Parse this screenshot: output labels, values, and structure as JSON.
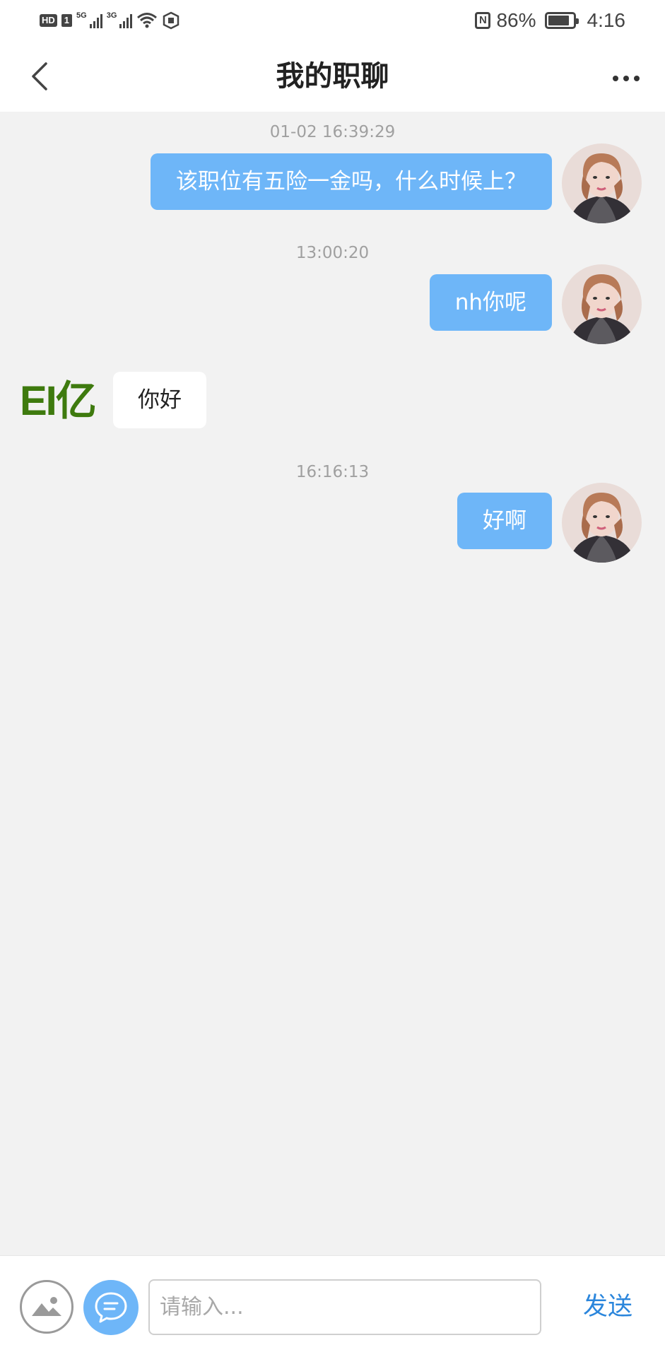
{
  "status_bar": {
    "hd_label": "HD",
    "sim_label": "1",
    "network1": "5G",
    "network2": "3G",
    "nfc_label": "N",
    "battery_percent": "86%",
    "battery_level": 0.86,
    "time": "4:16"
  },
  "header": {
    "title": "我的职聊"
  },
  "messages": [
    {
      "type": "timestamp",
      "text": "01-02 16:39:29"
    },
    {
      "type": "outgoing",
      "text": "该职位有五险一金吗，什么时候上？"
    },
    {
      "type": "timestamp",
      "text": "13:00:20"
    },
    {
      "type": "outgoing",
      "text": "nh你呢"
    },
    {
      "type": "incoming",
      "text": "你好",
      "avatar_text": "EI亿"
    },
    {
      "type": "timestamp",
      "text": "16:16:13"
    },
    {
      "type": "outgoing",
      "text": "好啊"
    }
  ],
  "input_bar": {
    "placeholder": "请输入...",
    "value": "",
    "send_label": "发送"
  },
  "colors": {
    "accent": "#6eb6f8",
    "send_text": "#2b86dc",
    "background": "#f2f2f2",
    "logo_green": "#3e7a0e"
  },
  "icons": {
    "back": "chevron-left-icon",
    "more": "more-dots-icon",
    "image": "image-icon",
    "chat": "chat-bubble-icon"
  }
}
